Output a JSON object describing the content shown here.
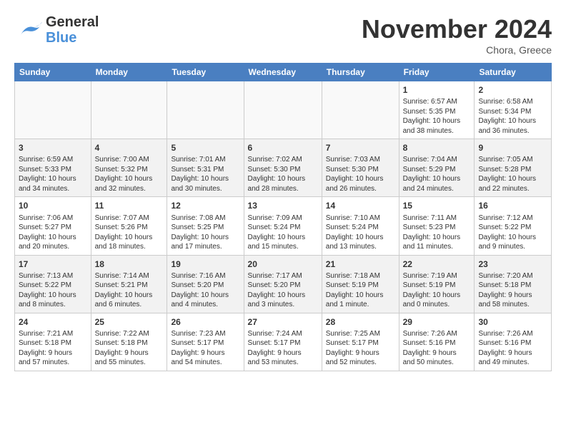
{
  "header": {
    "logo_general": "General",
    "logo_blue": "Blue",
    "month": "November 2024",
    "location": "Chora, Greece"
  },
  "columns": [
    "Sunday",
    "Monday",
    "Tuesday",
    "Wednesday",
    "Thursday",
    "Friday",
    "Saturday"
  ],
  "weeks": [
    {
      "days": [
        {
          "num": "",
          "info": "",
          "empty": true
        },
        {
          "num": "",
          "info": "",
          "empty": true
        },
        {
          "num": "",
          "info": "",
          "empty": true
        },
        {
          "num": "",
          "info": "",
          "empty": true
        },
        {
          "num": "",
          "info": "",
          "empty": true
        },
        {
          "num": "1",
          "info": "Sunrise: 6:57 AM\nSunset: 5:35 PM\nDaylight: 10 hours\nand 38 minutes.",
          "empty": false
        },
        {
          "num": "2",
          "info": "Sunrise: 6:58 AM\nSunset: 5:34 PM\nDaylight: 10 hours\nand 36 minutes.",
          "empty": false
        }
      ]
    },
    {
      "days": [
        {
          "num": "3",
          "info": "Sunrise: 6:59 AM\nSunset: 5:33 PM\nDaylight: 10 hours\nand 34 minutes.",
          "empty": false
        },
        {
          "num": "4",
          "info": "Sunrise: 7:00 AM\nSunset: 5:32 PM\nDaylight: 10 hours\nand 32 minutes.",
          "empty": false
        },
        {
          "num": "5",
          "info": "Sunrise: 7:01 AM\nSunset: 5:31 PM\nDaylight: 10 hours\nand 30 minutes.",
          "empty": false
        },
        {
          "num": "6",
          "info": "Sunrise: 7:02 AM\nSunset: 5:30 PM\nDaylight: 10 hours\nand 28 minutes.",
          "empty": false
        },
        {
          "num": "7",
          "info": "Sunrise: 7:03 AM\nSunset: 5:30 PM\nDaylight: 10 hours\nand 26 minutes.",
          "empty": false
        },
        {
          "num": "8",
          "info": "Sunrise: 7:04 AM\nSunset: 5:29 PM\nDaylight: 10 hours\nand 24 minutes.",
          "empty": false
        },
        {
          "num": "9",
          "info": "Sunrise: 7:05 AM\nSunset: 5:28 PM\nDaylight: 10 hours\nand 22 minutes.",
          "empty": false
        }
      ]
    },
    {
      "days": [
        {
          "num": "10",
          "info": "Sunrise: 7:06 AM\nSunset: 5:27 PM\nDaylight: 10 hours\nand 20 minutes.",
          "empty": false
        },
        {
          "num": "11",
          "info": "Sunrise: 7:07 AM\nSunset: 5:26 PM\nDaylight: 10 hours\nand 18 minutes.",
          "empty": false
        },
        {
          "num": "12",
          "info": "Sunrise: 7:08 AM\nSunset: 5:25 PM\nDaylight: 10 hours\nand 17 minutes.",
          "empty": false
        },
        {
          "num": "13",
          "info": "Sunrise: 7:09 AM\nSunset: 5:24 PM\nDaylight: 10 hours\nand 15 minutes.",
          "empty": false
        },
        {
          "num": "14",
          "info": "Sunrise: 7:10 AM\nSunset: 5:24 PM\nDaylight: 10 hours\nand 13 minutes.",
          "empty": false
        },
        {
          "num": "15",
          "info": "Sunrise: 7:11 AM\nSunset: 5:23 PM\nDaylight: 10 hours\nand 11 minutes.",
          "empty": false
        },
        {
          "num": "16",
          "info": "Sunrise: 7:12 AM\nSunset: 5:22 PM\nDaylight: 10 hours\nand 9 minutes.",
          "empty": false
        }
      ]
    },
    {
      "days": [
        {
          "num": "17",
          "info": "Sunrise: 7:13 AM\nSunset: 5:22 PM\nDaylight: 10 hours\nand 8 minutes.",
          "empty": false
        },
        {
          "num": "18",
          "info": "Sunrise: 7:14 AM\nSunset: 5:21 PM\nDaylight: 10 hours\nand 6 minutes.",
          "empty": false
        },
        {
          "num": "19",
          "info": "Sunrise: 7:16 AM\nSunset: 5:20 PM\nDaylight: 10 hours\nand 4 minutes.",
          "empty": false
        },
        {
          "num": "20",
          "info": "Sunrise: 7:17 AM\nSunset: 5:20 PM\nDaylight: 10 hours\nand 3 minutes.",
          "empty": false
        },
        {
          "num": "21",
          "info": "Sunrise: 7:18 AM\nSunset: 5:19 PM\nDaylight: 10 hours\nand 1 minute.",
          "empty": false
        },
        {
          "num": "22",
          "info": "Sunrise: 7:19 AM\nSunset: 5:19 PM\nDaylight: 10 hours\nand 0 minutes.",
          "empty": false
        },
        {
          "num": "23",
          "info": "Sunrise: 7:20 AM\nSunset: 5:18 PM\nDaylight: 9 hours\nand 58 minutes.",
          "empty": false
        }
      ]
    },
    {
      "days": [
        {
          "num": "24",
          "info": "Sunrise: 7:21 AM\nSunset: 5:18 PM\nDaylight: 9 hours\nand 57 minutes.",
          "empty": false
        },
        {
          "num": "25",
          "info": "Sunrise: 7:22 AM\nSunset: 5:18 PM\nDaylight: 9 hours\nand 55 minutes.",
          "empty": false
        },
        {
          "num": "26",
          "info": "Sunrise: 7:23 AM\nSunset: 5:17 PM\nDaylight: 9 hours\nand 54 minutes.",
          "empty": false
        },
        {
          "num": "27",
          "info": "Sunrise: 7:24 AM\nSunset: 5:17 PM\nDaylight: 9 hours\nand 53 minutes.",
          "empty": false
        },
        {
          "num": "28",
          "info": "Sunrise: 7:25 AM\nSunset: 5:17 PM\nDaylight: 9 hours\nand 52 minutes.",
          "empty": false
        },
        {
          "num": "29",
          "info": "Sunrise: 7:26 AM\nSunset: 5:16 PM\nDaylight: 9 hours\nand 50 minutes.",
          "empty": false
        },
        {
          "num": "30",
          "info": "Sunrise: 7:26 AM\nSunset: 5:16 PM\nDaylight: 9 hours\nand 49 minutes.",
          "empty": false
        }
      ]
    }
  ]
}
